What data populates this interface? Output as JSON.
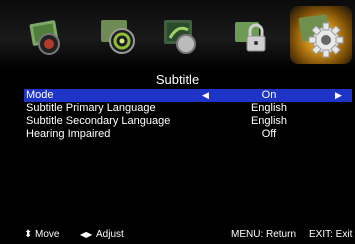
{
  "icons": [
    {
      "name": "picture-menu-icon",
      "selected": false
    },
    {
      "name": "sound-menu-icon",
      "selected": false
    },
    {
      "name": "channel-menu-icon",
      "selected": false
    },
    {
      "name": "lock-menu-icon",
      "selected": false
    },
    {
      "name": "setup-gear-menu-icon",
      "selected": true
    }
  ],
  "title": "Subtitle",
  "rows": [
    {
      "label": "Mode",
      "value": "On"
    },
    {
      "label": "Subtitle Primary Language",
      "value": "English"
    },
    {
      "label": "Subtitle Secondary Language",
      "value": "English"
    },
    {
      "label": "Hearing Impaired",
      "value": "Off"
    }
  ],
  "arrows": {
    "left": "◀",
    "right": "▶"
  },
  "footer": {
    "move_icon": "⬍",
    "move": "Move",
    "adjust_icon": "◀▶",
    "adjust": "Adjust",
    "menu": "MENU: Return",
    "exit": "EXIT: Exit"
  },
  "colors": {
    "highlight": "#1e34c7",
    "accent": "#d49a1e"
  }
}
